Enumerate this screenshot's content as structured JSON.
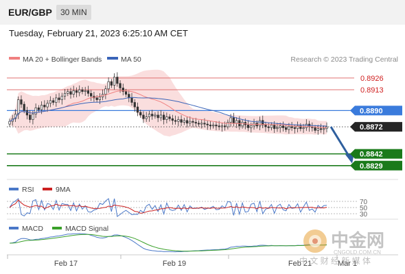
{
  "header": {
    "symbol": "EUR/GBP",
    "interval": "30 MIN"
  },
  "timestamp": "Tuesday, February 21, 2023 6:25:10 AM CET",
  "legend": {
    "bollinger": "MA 20 + Bollinger Bands",
    "ma50": "MA 50",
    "credit": "Research © 2023 Trading Central",
    "rsi": "RSI",
    "rsi_ma": "9MA",
    "macd": "MACD",
    "macd_signal": "MACD Signal"
  },
  "colors": {
    "bollinger": "#f08080",
    "band_fill": "#fadada",
    "ma50": "#3a64b8",
    "resistance": "#e07070",
    "pivot": "#3a7bdc",
    "support": "#1a7a1a",
    "current": "#262626",
    "arrow": "#2f5f9e",
    "rsi": "#4a78c8",
    "rsi_ma": "#cc2020",
    "macd": "#4a78c8",
    "macd_signal": "#3aa02a"
  },
  "watermark": {
    "brand": "中金网",
    "url": "CNGOLD.COM.CN",
    "tagline": "中 文 财 经 新 媒 体"
  },
  "chart_data": {
    "type": "candlestick",
    "instrument": "EUR/GBP",
    "timeframe": "30 MIN",
    "ylim": [
      0.8822,
      0.8932
    ],
    "levels": [
      {
        "label": "0.8926",
        "value": 0.8926,
        "kind": "resistance"
      },
      {
        "label": "0.8913",
        "value": 0.8913,
        "kind": "resistance"
      },
      {
        "label": "0.8890",
        "value": 0.889,
        "kind": "pivot"
      },
      {
        "label": "0.8872",
        "value": 0.8872,
        "kind": "current"
      },
      {
        "label": "0.8842",
        "value": 0.8842,
        "kind": "support"
      },
      {
        "label": "0.8829",
        "value": 0.8829,
        "kind": "support"
      }
    ],
    "x_ticks": [
      "Feb 17",
      "Feb 19",
      "Feb 21",
      "Mar 1"
    ],
    "rsi_levels": [
      "70",
      "50",
      "30"
    ],
    "closes": [
      0.8878,
      0.8881,
      0.8886,
      0.8902,
      0.8897,
      0.889,
      0.8885,
      0.888,
      0.8886,
      0.8893,
      0.8891,
      0.8896,
      0.8894,
      0.8898,
      0.8901,
      0.8899,
      0.8904,
      0.8902,
      0.8906,
      0.8909,
      0.8911,
      0.8908,
      0.8912,
      0.891,
      0.8913,
      0.8911,
      0.8912,
      0.8909,
      0.8906,
      0.8904,
      0.8902,
      0.8905,
      0.8908,
      0.8914,
      0.8922,
      0.8918,
      0.8927,
      0.892,
      0.8915,
      0.8911,
      0.8908,
      0.8904,
      0.8899,
      0.8894,
      0.8888,
      0.8885,
      0.8881,
      0.8883,
      0.8886,
      0.8884,
      0.8885,
      0.8882,
      0.8885,
      0.888,
      0.8883,
      0.8881,
      0.8879,
      0.8878,
      0.888,
      0.8877,
      0.8879,
      0.8876,
      0.8878,
      0.8877,
      0.8876,
      0.8875,
      0.8876,
      0.8875,
      0.8874,
      0.8873,
      0.8874,
      0.8873,
      0.8872,
      0.8873,
      0.8872,
      0.8877,
      0.8882,
      0.8876,
      0.8879,
      0.8873,
      0.8877,
      0.8874,
      0.8871,
      0.8873,
      0.8876,
      0.8873,
      0.8879,
      0.8874,
      0.8872,
      0.8871,
      0.8874,
      0.887,
      0.8871,
      0.8873,
      0.8871,
      0.8869,
      0.8872,
      0.8871,
      0.887,
      0.8873,
      0.887,
      0.8871,
      0.8875,
      0.8872,
      0.8871,
      0.8868,
      0.887,
      0.8869,
      0.887,
      0.8872
    ],
    "forecast": {
      "from": 0.8872,
      "to": 0.8842
    }
  }
}
